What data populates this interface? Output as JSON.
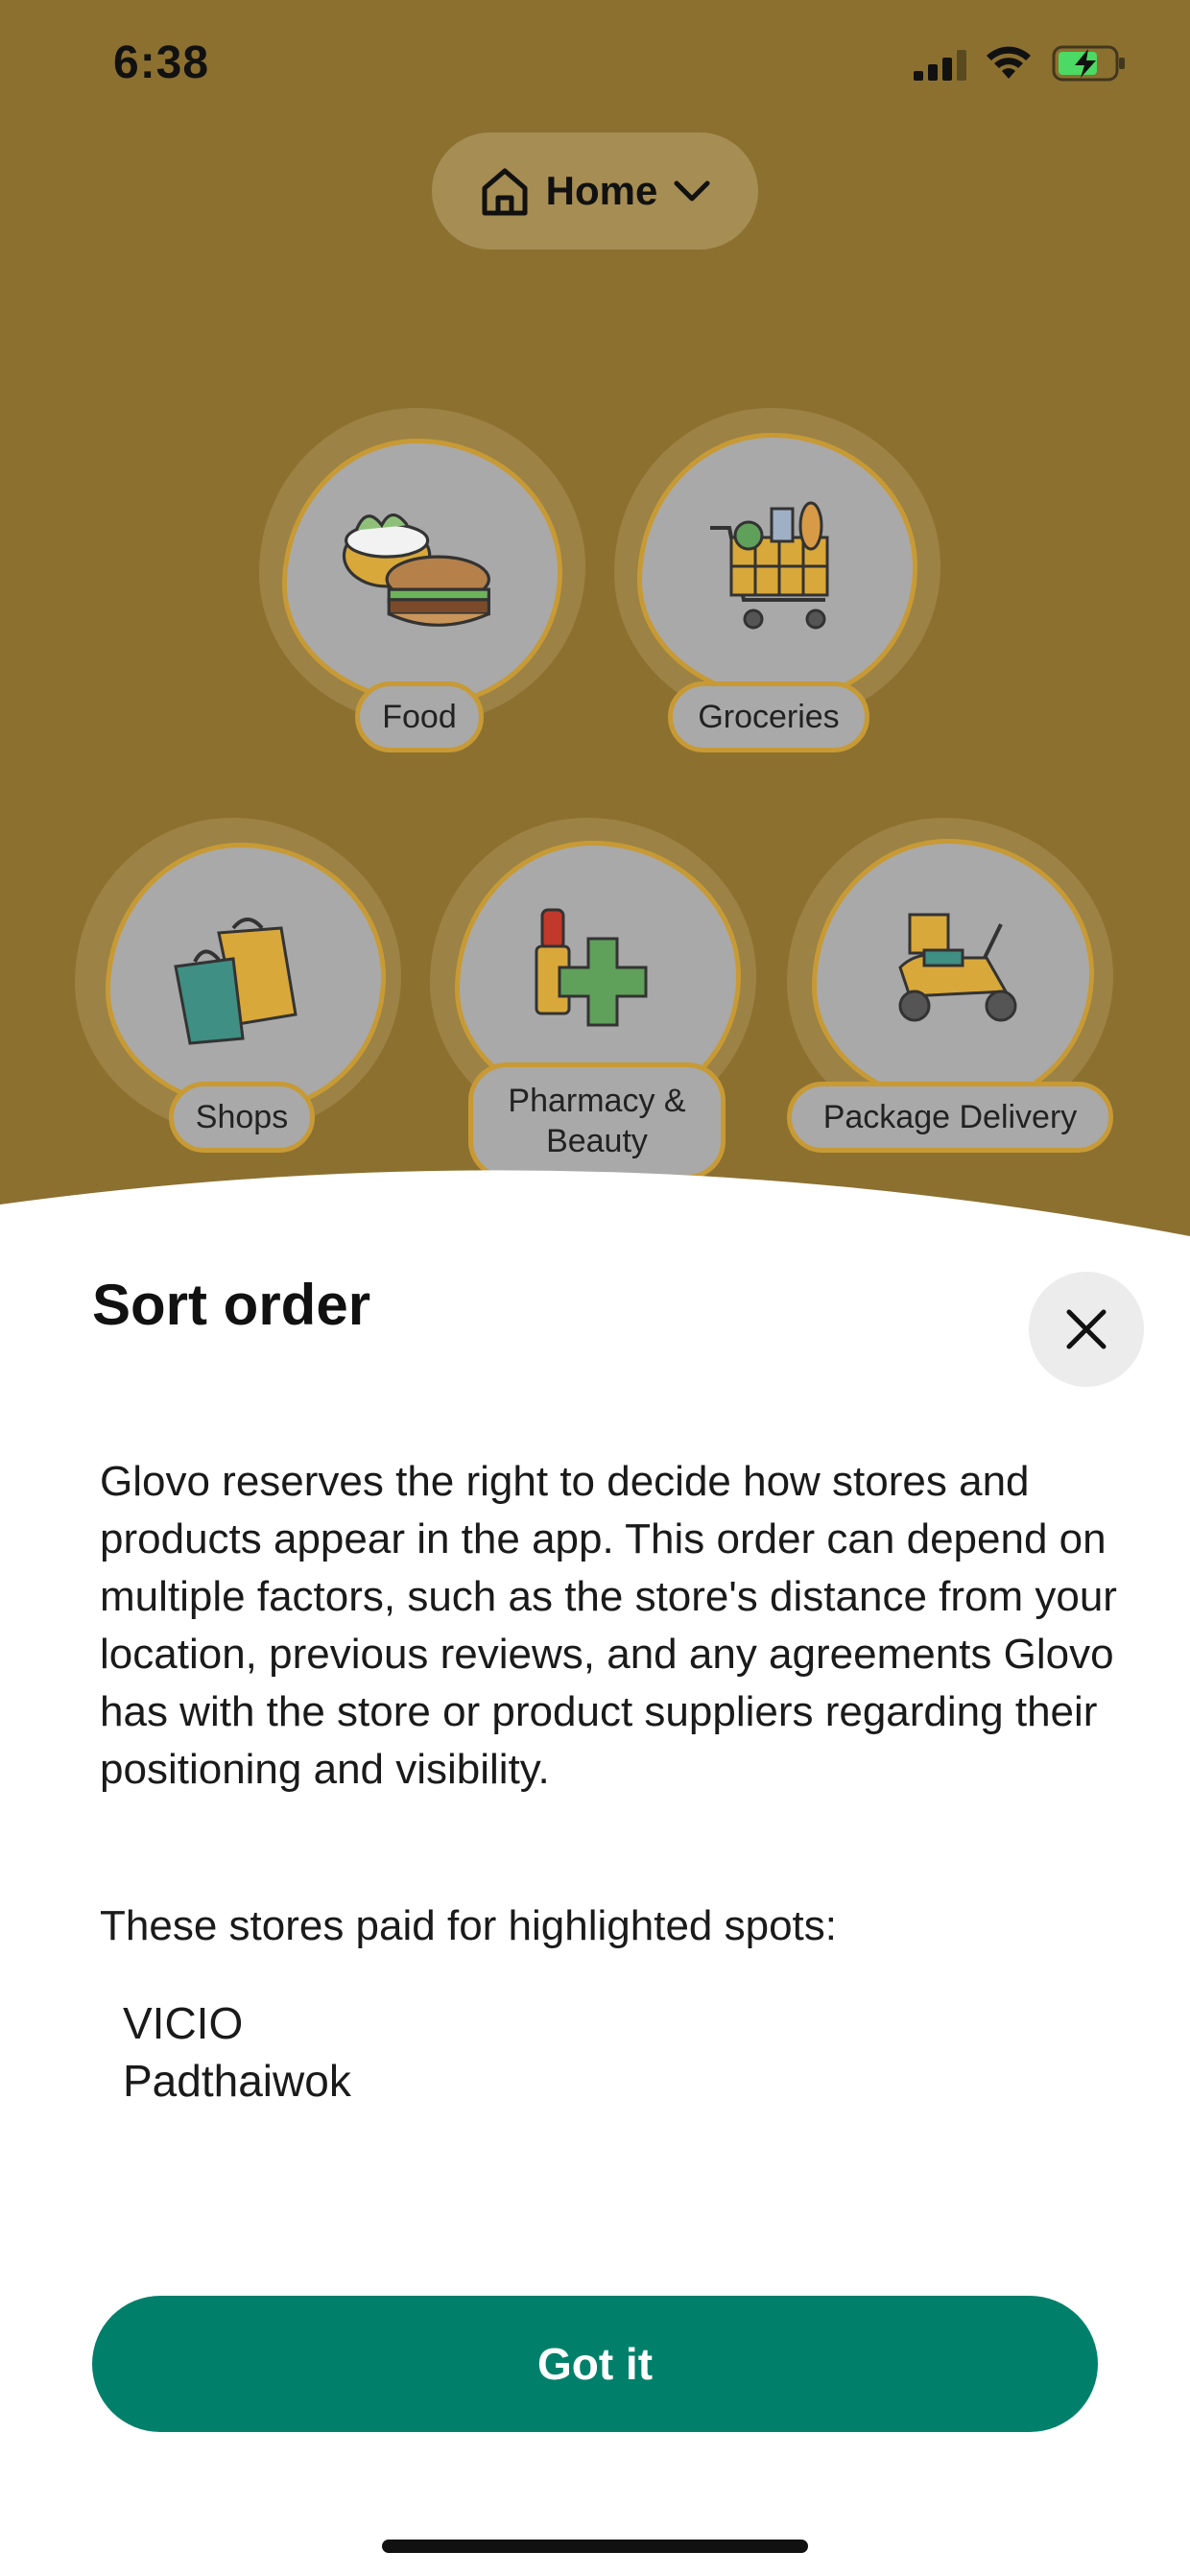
{
  "status_bar": {
    "time": "6:38"
  },
  "header": {
    "location_label": "Home"
  },
  "categories": [
    {
      "label": "Food",
      "icon": "food-icon"
    },
    {
      "label": "Groceries",
      "icon": "groceries-icon"
    },
    {
      "label": "Shops",
      "icon": "shops-icon"
    },
    {
      "label": "Pharmacy &\nBeauty",
      "icon": "pharmacy-icon"
    },
    {
      "label": "Package Delivery",
      "icon": "package-delivery-icon"
    }
  ],
  "sheet": {
    "title": "Sort order",
    "body": "Glovo reserves the right to decide how stores and products appear in the app. This order can depend on multiple factors, such as the store's distance from your location, previous reviews, and any agreements Glovo has with the store or product suppliers regarding their positioning and visibility.",
    "paid_heading": "These stores paid for highlighted spots:",
    "stores": [
      "VICIO",
      "Padthaiwok"
    ],
    "button_label": "Got it"
  },
  "colors": {
    "background": "#8c7030",
    "bubble": "#a9a9a9",
    "bubble_border": "#c79a35",
    "primary_button": "#00806a"
  }
}
